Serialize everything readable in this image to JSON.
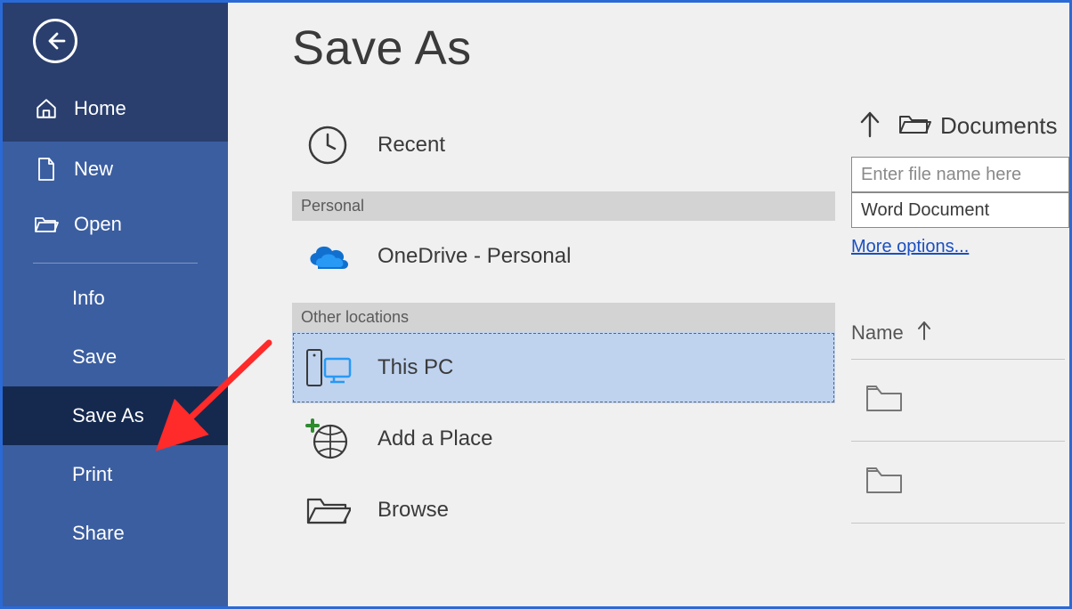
{
  "sidebar": {
    "home": "Home",
    "new": "New",
    "open": "Open",
    "info": "Info",
    "save": "Save",
    "save_as": "Save As",
    "print": "Print",
    "share": "Share"
  },
  "page_title": "Save As",
  "locations": {
    "recent": "Recent",
    "section_personal": "Personal",
    "onedrive": "OneDrive - Personal",
    "section_other": "Other locations",
    "this_pc": "This PC",
    "add_place": "Add a Place",
    "browse": "Browse"
  },
  "right_pane": {
    "current_folder": "Documents",
    "filename_placeholder": "Enter file name here",
    "file_type": "Word Document",
    "more_options": "More options...",
    "name_column": "Name"
  },
  "annotation": {
    "arrow_color": "#ff2a2a"
  }
}
